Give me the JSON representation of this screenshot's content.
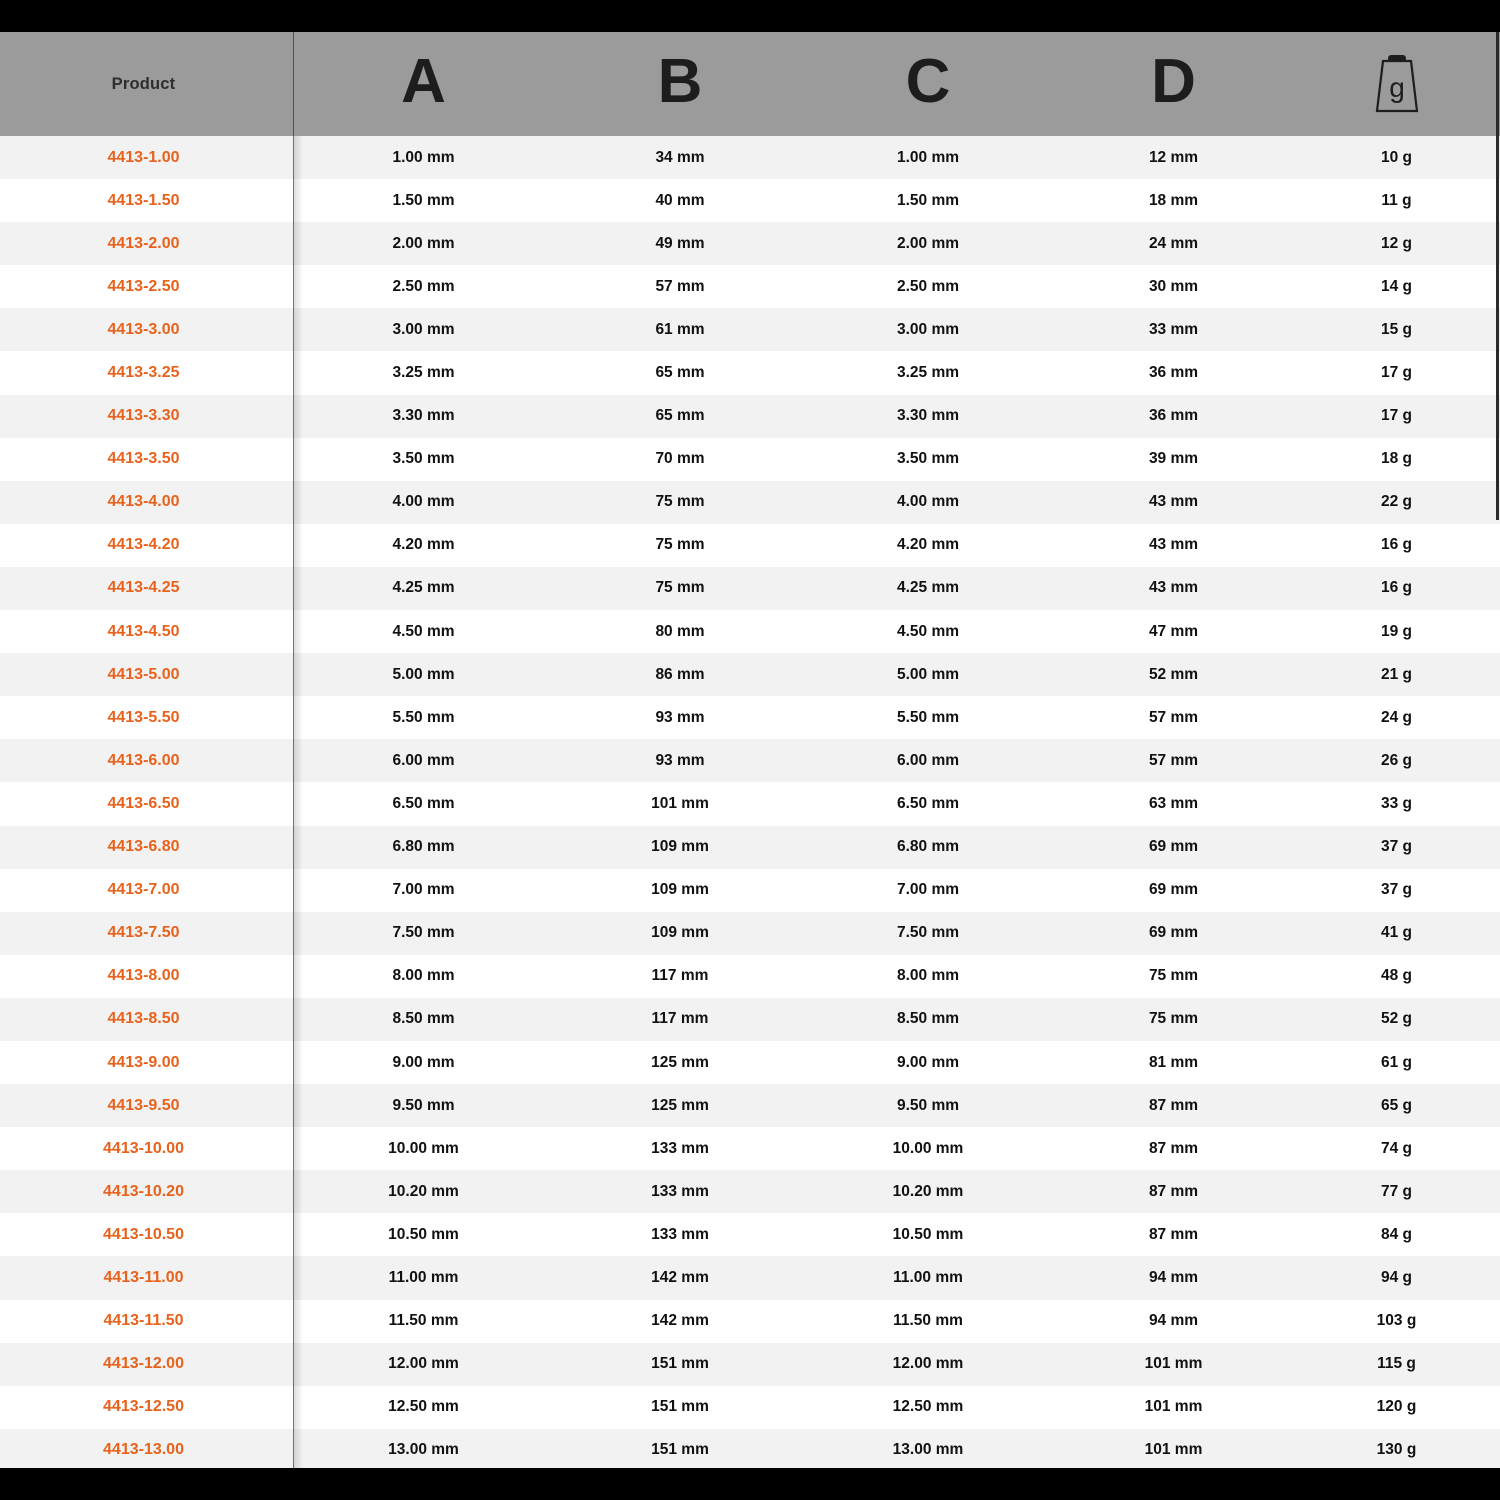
{
  "colors": {
    "accent_product": "#e8621c",
    "header_background": "#9b9b9b",
    "row_odd": "#f2f2f2",
    "row_even": "#ffffff",
    "frame": "#000000",
    "text": "#111111"
  },
  "table": {
    "columns": [
      {
        "key": "product",
        "label": "Product",
        "type": "text"
      },
      {
        "key": "a",
        "label": "A",
        "type": "letter"
      },
      {
        "key": "b",
        "label": "B",
        "type": "letter"
      },
      {
        "key": "c",
        "label": "C",
        "type": "letter"
      },
      {
        "key": "d",
        "label": "D",
        "type": "letter"
      },
      {
        "key": "g",
        "label": "g",
        "type": "icon",
        "icon": "weight-g-icon"
      }
    ],
    "rows": [
      {
        "product": "4413-1.00",
        "a": "1.00 mm",
        "b": "34 mm",
        "c": "1.00 mm",
        "d": "12 mm",
        "g": "10 g"
      },
      {
        "product": "4413-1.50",
        "a": "1.50 mm",
        "b": "40 mm",
        "c": "1.50 mm",
        "d": "18 mm",
        "g": "11 g"
      },
      {
        "product": "4413-2.00",
        "a": "2.00 mm",
        "b": "49 mm",
        "c": "2.00 mm",
        "d": "24 mm",
        "g": "12 g"
      },
      {
        "product": "4413-2.50",
        "a": "2.50 mm",
        "b": "57 mm",
        "c": "2.50 mm",
        "d": "30 mm",
        "g": "14 g"
      },
      {
        "product": "4413-3.00",
        "a": "3.00 mm",
        "b": "61 mm",
        "c": "3.00 mm",
        "d": "33 mm",
        "g": "15 g"
      },
      {
        "product": "4413-3.25",
        "a": "3.25 mm",
        "b": "65 mm",
        "c": "3.25 mm",
        "d": "36 mm",
        "g": "17 g"
      },
      {
        "product": "4413-3.30",
        "a": "3.30 mm",
        "b": "65 mm",
        "c": "3.30 mm",
        "d": "36 mm",
        "g": "17 g"
      },
      {
        "product": "4413-3.50",
        "a": "3.50 mm",
        "b": "70 mm",
        "c": "3.50 mm",
        "d": "39 mm",
        "g": "18 g"
      },
      {
        "product": "4413-4.00",
        "a": "4.00 mm",
        "b": "75 mm",
        "c": "4.00 mm",
        "d": "43 mm",
        "g": "22 g"
      },
      {
        "product": "4413-4.20",
        "a": "4.20 mm",
        "b": "75 mm",
        "c": "4.20 mm",
        "d": "43 mm",
        "g": "16 g"
      },
      {
        "product": "4413-4.25",
        "a": "4.25 mm",
        "b": "75 mm",
        "c": "4.25 mm",
        "d": "43 mm",
        "g": "16 g"
      },
      {
        "product": "4413-4.50",
        "a": "4.50 mm",
        "b": "80 mm",
        "c": "4.50 mm",
        "d": "47 mm",
        "g": "19 g"
      },
      {
        "product": "4413-5.00",
        "a": "5.00 mm",
        "b": "86 mm",
        "c": "5.00 mm",
        "d": "52 mm",
        "g": "21 g"
      },
      {
        "product": "4413-5.50",
        "a": "5.50 mm",
        "b": "93 mm",
        "c": "5.50 mm",
        "d": "57 mm",
        "g": "24 g"
      },
      {
        "product": "4413-6.00",
        "a": "6.00 mm",
        "b": "93 mm",
        "c": "6.00 mm",
        "d": "57 mm",
        "g": "26 g"
      },
      {
        "product": "4413-6.50",
        "a": "6.50 mm",
        "b": "101 mm",
        "c": "6.50 mm",
        "d": "63 mm",
        "g": "33 g"
      },
      {
        "product": "4413-6.80",
        "a": "6.80 mm",
        "b": "109 mm",
        "c": "6.80 mm",
        "d": "69 mm",
        "g": "37 g"
      },
      {
        "product": "4413-7.00",
        "a": "7.00 mm",
        "b": "109 mm",
        "c": "7.00 mm",
        "d": "69 mm",
        "g": "37 g"
      },
      {
        "product": "4413-7.50",
        "a": "7.50 mm",
        "b": "109 mm",
        "c": "7.50 mm",
        "d": "69 mm",
        "g": "41 g"
      },
      {
        "product": "4413-8.00",
        "a": "8.00 mm",
        "b": "117 mm",
        "c": "8.00 mm",
        "d": "75 mm",
        "g": "48 g"
      },
      {
        "product": "4413-8.50",
        "a": "8.50 mm",
        "b": "117 mm",
        "c": "8.50 mm",
        "d": "75 mm",
        "g": "52 g"
      },
      {
        "product": "4413-9.00",
        "a": "9.00 mm",
        "b": "125 mm",
        "c": "9.00 mm",
        "d": "81 mm",
        "g": "61 g"
      },
      {
        "product": "4413-9.50",
        "a": "9.50 mm",
        "b": "125 mm",
        "c": "9.50 mm",
        "d": "87 mm",
        "g": "65 g"
      },
      {
        "product": "4413-10.00",
        "a": "10.00 mm",
        "b": "133 mm",
        "c": "10.00 mm",
        "d": "87 mm",
        "g": "74 g"
      },
      {
        "product": "4413-10.20",
        "a": "10.20 mm",
        "b": "133 mm",
        "c": "10.20 mm",
        "d": "87 mm",
        "g": "77 g"
      },
      {
        "product": "4413-10.50",
        "a": "10.50 mm",
        "b": "133 mm",
        "c": "10.50 mm",
        "d": "87 mm",
        "g": "84 g"
      },
      {
        "product": "4413-11.00",
        "a": "11.00 mm",
        "b": "142 mm",
        "c": "11.00 mm",
        "d": "94 mm",
        "g": "94 g"
      },
      {
        "product": "4413-11.50",
        "a": "11.50 mm",
        "b": "142 mm",
        "c": "11.50 mm",
        "d": "94 mm",
        "g": "103 g"
      },
      {
        "product": "4413-12.00",
        "a": "12.00 mm",
        "b": "151 mm",
        "c": "12.00 mm",
        "d": "101 mm",
        "g": "115 g"
      },
      {
        "product": "4413-12.50",
        "a": "12.50 mm",
        "b": "151 mm",
        "c": "12.50 mm",
        "d": "101 mm",
        "g": "120 g"
      },
      {
        "product": "4413-13.00",
        "a": "13.00 mm",
        "b": "151 mm",
        "c": "13.00 mm",
        "d": "101 mm",
        "g": "130 g"
      }
    ]
  },
  "scrollbar": {
    "orientation": "vertical",
    "thumb_label": ""
  }
}
